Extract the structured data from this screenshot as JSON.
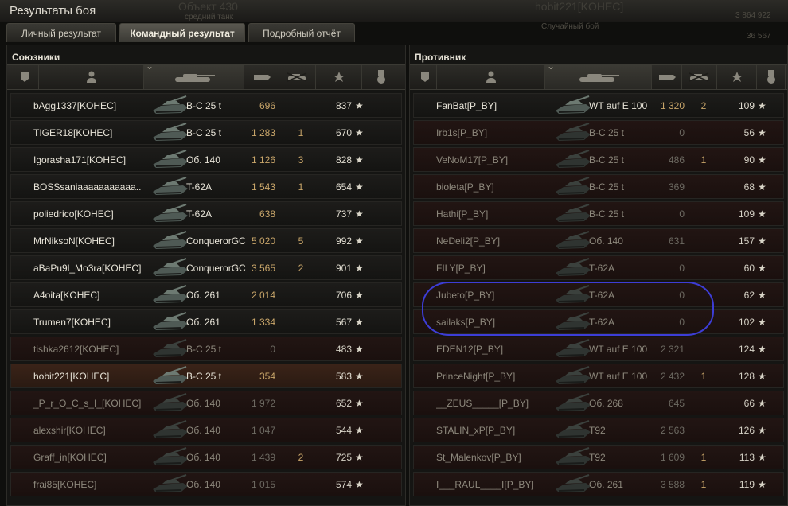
{
  "window": {
    "title": "Результаты боя",
    "bg_vehicle": "Объект 430",
    "bg_vehicle_class": "средний танк",
    "bg_player": "hobit221[KOHEC]",
    "bg_mode": "Случайный бой",
    "bg_credits": "3 864 922",
    "bg_xp": "36 567"
  },
  "tabs": [
    {
      "label": "Личный результат",
      "active": false
    },
    {
      "label": "Командный результат",
      "active": true
    },
    {
      "label": "Подробный отчёт",
      "active": false
    }
  ],
  "allies": {
    "title": "Союзники",
    "rows": [
      {
        "name": "bAgg1337[KOHEC]",
        "vehicle": "B-C 25 t",
        "damage": "696",
        "kills": "",
        "xp": "837",
        "status": "alive"
      },
      {
        "name": "TIGER18[KOHEC]",
        "vehicle": "B-C 25 t",
        "damage": "1 283",
        "kills": "1",
        "xp": "670",
        "status": "alive"
      },
      {
        "name": "Igorasha171[KOHEC]",
        "vehicle": "Об. 140",
        "damage": "1 126",
        "kills": "3",
        "xp": "828",
        "status": "alive"
      },
      {
        "name": "BOSSsaniaaaaaaaaaaa..",
        "vehicle": "T-62A",
        "damage": "1 543",
        "kills": "1",
        "xp": "654",
        "status": "alive"
      },
      {
        "name": "poliedrico[KOHEC]",
        "vehicle": "T-62A",
        "damage": "638",
        "kills": "",
        "xp": "737",
        "status": "alive"
      },
      {
        "name": "MrNiksoN[KOHEC]",
        "vehicle": "ConquerorGC",
        "damage": "5 020",
        "kills": "5",
        "xp": "992",
        "status": "alive"
      },
      {
        "name": "aBaPu9l_Mo3ra[KOHEC]",
        "vehicle": "ConquerorGC",
        "damage": "3 565",
        "kills": "2",
        "xp": "901",
        "status": "alive"
      },
      {
        "name": "A4oita[KOHEC]",
        "vehicle": "Об. 261",
        "damage": "2 014",
        "kills": "",
        "xp": "706",
        "status": "alive"
      },
      {
        "name": "Trumen7[KOHEC]",
        "vehicle": "Об. 261",
        "damage": "1 334",
        "kills": "",
        "xp": "567",
        "status": "alive"
      },
      {
        "name": "tishka2612[KOHEC]",
        "vehicle": "B-C 25 t",
        "damage": "0",
        "kills": "",
        "xp": "483",
        "status": "dead"
      },
      {
        "name": "hobit221[KOHEC]",
        "vehicle": "B-C 25 t",
        "damage": "354",
        "kills": "",
        "xp": "583",
        "status": "me"
      },
      {
        "name": "_P_r_O_C_s_I_[KOHEC]",
        "vehicle": "Об. 140",
        "damage": "1 972",
        "kills": "",
        "xp": "652",
        "status": "dead"
      },
      {
        "name": "alexshir[KOHEC]",
        "vehicle": "Об. 140",
        "damage": "1 047",
        "kills": "",
        "xp": "544",
        "status": "dead"
      },
      {
        "name": "Graff_in[KOHEC]",
        "vehicle": "Об. 140",
        "damage": "1 439",
        "kills": "2",
        "xp": "725",
        "status": "dead"
      },
      {
        "name": "frai85[KOHEC]",
        "vehicle": "Об. 140",
        "damage": "1 015",
        "kills": "",
        "xp": "574",
        "status": "dead"
      }
    ]
  },
  "enemies": {
    "title": "Противник",
    "rows": [
      {
        "name": "FanBat[P_BY]",
        "vehicle": "WT auf E 100",
        "damage": "1 320",
        "kills": "2",
        "xp": "109",
        "status": "alive"
      },
      {
        "name": "Irb1s[P_BY]",
        "vehicle": "B-C 25 t",
        "damage": "0",
        "kills": "",
        "xp": "56",
        "status": "dead"
      },
      {
        "name": "VeNoM17[P_BY]",
        "vehicle": "B-C 25 t",
        "damage": "486",
        "kills": "1",
        "xp": "90",
        "status": "dead"
      },
      {
        "name": "bioleta[P_BY]",
        "vehicle": "B-C 25 t",
        "damage": "369",
        "kills": "",
        "xp": "68",
        "status": "dead"
      },
      {
        "name": "Hathi[P_BY]",
        "vehicle": "B-C 25 t",
        "damage": "0",
        "kills": "",
        "xp": "109",
        "status": "dead"
      },
      {
        "name": "NeDeli2[P_BY]",
        "vehicle": "Об. 140",
        "damage": "631",
        "kills": "",
        "xp": "157",
        "status": "dead"
      },
      {
        "name": "FILY[P_BY]",
        "vehicle": "T-62A",
        "damage": "0",
        "kills": "",
        "xp": "60",
        "status": "dead"
      },
      {
        "name": "Jubeto[P_BY]",
        "vehicle": "T-62A",
        "damage": "0",
        "kills": "",
        "xp": "62",
        "status": "dead"
      },
      {
        "name": "sailaks[P_BY]",
        "vehicle": "T-62A",
        "damage": "0",
        "kills": "",
        "xp": "102",
        "status": "dead"
      },
      {
        "name": "EDEN12[P_BY]",
        "vehicle": "WT auf E 100",
        "damage": "2 321",
        "kills": "",
        "xp": "124",
        "status": "dead"
      },
      {
        "name": "PrinceNight[P_BY]",
        "vehicle": "WT auf E 100",
        "damage": "2 432",
        "kills": "1",
        "xp": "128",
        "status": "dead"
      },
      {
        "name": "__ZEUS_____[P_BY]",
        "vehicle": "Об. 268",
        "damage": "645",
        "kills": "",
        "xp": "66",
        "status": "dead"
      },
      {
        "name": "STALIN_xP[P_BY]",
        "vehicle": "T92",
        "damage": "2 563",
        "kills": "",
        "xp": "126",
        "status": "dead"
      },
      {
        "name": "St_Malenkov[P_BY]",
        "vehicle": "T92",
        "damage": "1 609",
        "kills": "1",
        "xp": "113",
        "status": "dead"
      },
      {
        "name": "I___RAUL____I[P_BY]",
        "vehicle": "Об. 261",
        "damage": "3 588",
        "kills": "1",
        "xp": "119",
        "status": "dead"
      }
    ]
  },
  "icons": {
    "squad": "squad-badge-icon",
    "player": "player-silhouette-icon",
    "vehicle": "tank-icon",
    "damage": "shell-icon",
    "kills": "destroyed-tank-icon",
    "xp": "star-icon",
    "medal": "medal-icon",
    "row_star": "★"
  },
  "colors": {
    "damage_alive": "#c9a66a",
    "highlight_oval": "#3d3dd6",
    "player_row": "#3a2318"
  }
}
